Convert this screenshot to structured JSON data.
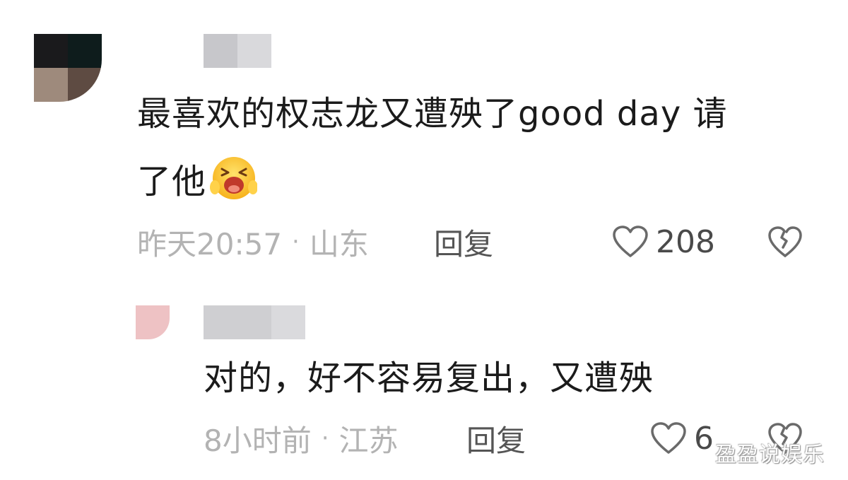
{
  "comments": [
    {
      "text_line1": "最喜欢的权志龙又遭殃了good day 请",
      "text_line2": "了他",
      "emoji": "crying-face-emoji",
      "time": "昨天20:57",
      "separator": "·",
      "location": "山东",
      "reply_label": "回复",
      "like_count": "208",
      "like_icon": "heart-outline-icon",
      "dislike_icon": "broken-heart-icon"
    },
    {
      "text": "对的，好不容易复出，又遭殃",
      "time": "8小时前",
      "separator": "·",
      "location": "江苏",
      "reply_label": "回复",
      "like_count": "6",
      "like_icon": "heart-outline-icon",
      "dislike_icon": "broken-heart-icon"
    }
  ],
  "watermark": "盈盈说娱乐",
  "colors": {
    "text": "#1b1b1b",
    "meta": "#b3b3b3",
    "action": "#555555",
    "emoji_face": "#ffc93c",
    "emoji_mouth": "#c0392b"
  }
}
